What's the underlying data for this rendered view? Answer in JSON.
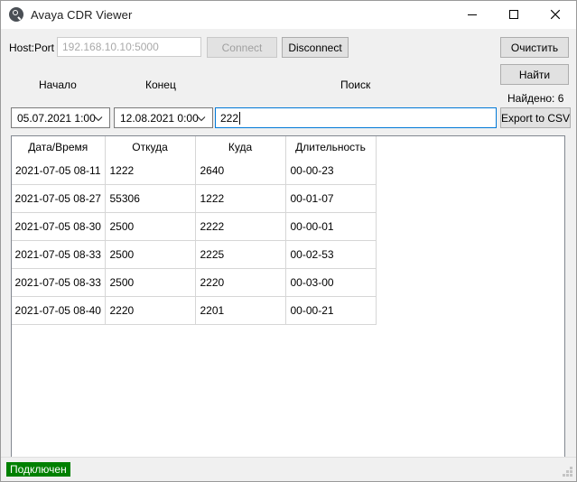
{
  "window": {
    "title": "Avaya CDR Viewer",
    "icon": "magnifier-icon",
    "minimize_label": "─",
    "maximize_label": "□",
    "close_label": "✕"
  },
  "connection": {
    "host_port_label": "Host:Port",
    "host_port_placeholder": "192.168.10.10:5000",
    "host_port_value": "",
    "connect_label": "Connect",
    "connect_enabled": false,
    "disconnect_label": "Disconnect",
    "disconnect_enabled": true
  },
  "filters": {
    "start_label": "Начало",
    "start_value": "05.07.2021 1:00",
    "end_label": "Конец",
    "end_value": "12.08.2021 0:00",
    "search_label": "Поиск",
    "search_value": "222",
    "search_placeholder": ""
  },
  "actions": {
    "clear_label": "Очистить",
    "find_label": "Найти",
    "found_label": "Найдено: 6",
    "export_label": "Export to CSV"
  },
  "table": {
    "columns": [
      "Дата/Время",
      "Откуда",
      "Куда",
      "Длительность"
    ],
    "rows": [
      [
        "2021-07-05 08-11",
        "1222",
        "2640",
        "00-00-23"
      ],
      [
        "2021-07-05 08-27",
        "55306",
        "1222",
        "00-01-07"
      ],
      [
        "2021-07-05 08-30",
        "2500",
        "2222",
        "00-00-01"
      ],
      [
        "2021-07-05 08-33",
        "2500",
        "2225",
        "00-02-53"
      ],
      [
        "2021-07-05 08-33",
        "2500",
        "2220",
        "00-03-00"
      ],
      [
        "2021-07-05 08-40",
        "2220",
        "2201",
        "00-00-21"
      ]
    ]
  },
  "status": {
    "text": "Подключен",
    "color": "#008000"
  }
}
